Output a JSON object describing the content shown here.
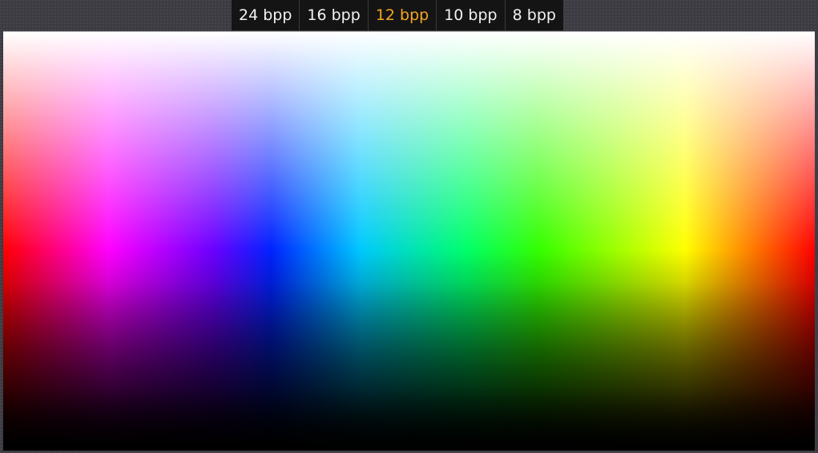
{
  "toolbar": {
    "tabs": [
      {
        "label": "24 bpp",
        "active": false
      },
      {
        "label": "16 bpp",
        "active": false
      },
      {
        "label": "12 bpp",
        "active": true
      },
      {
        "label": "10 bpp",
        "active": false
      },
      {
        "label": "8 bpp",
        "active": false
      }
    ],
    "active_color": "#f5a623"
  },
  "canvas": {
    "description_colors": [
      "#ff0000",
      "#ff00ff",
      "#0022ff",
      "#00c8ff",
      "#00ff6a",
      "#ffff00",
      "#ff0000"
    ]
  }
}
